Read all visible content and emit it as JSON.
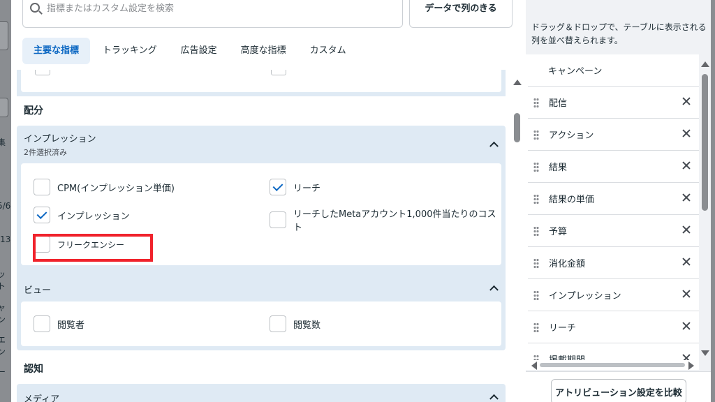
{
  "background": {
    "left_fragments": [
      "集",
      "5/6",
      "/13",
      "ット",
      "ャン",
      "エン",
      "ー"
    ]
  },
  "search": {
    "placeholder": "指標またはカスタム設定を検索"
  },
  "compare_top_label": "データで列のきる",
  "tabs": [
    {
      "label": "主要な指標",
      "active": true
    },
    {
      "label": "トラッキング",
      "active": false
    },
    {
      "label": "広告設定",
      "active": false
    },
    {
      "label": "高度な指標",
      "active": false
    },
    {
      "label": "カスタム",
      "active": false
    }
  ],
  "sections": {
    "distribution": {
      "title": "配分",
      "impressions_group": {
        "title": "インプレッション",
        "subtitle": "2件選択済み",
        "options": [
          {
            "label": "CPM(インプレッション単価)",
            "checked": false
          },
          {
            "label": "リーチ",
            "checked": true
          },
          {
            "label": "インプレッション",
            "checked": true
          },
          {
            "label": "リーチしたMetaアカウント1,000件当たりのコスト",
            "checked": false
          },
          {
            "label": "フリークエンシー",
            "checked": false
          }
        ]
      },
      "views_group": {
        "title": "ビュー",
        "options": [
          {
            "label": "閲覧者",
            "checked": false
          },
          {
            "label": "閲覧数",
            "checked": false
          }
        ]
      }
    },
    "awareness": {
      "title": "認知",
      "media_group": {
        "title": "メディア"
      }
    }
  },
  "right_panel": {
    "hint": "ドラッグ＆ドロップで、テーブルに表示される列を並べ替えられます。",
    "columns": [
      {
        "label": "キャンペーン",
        "fixed": true
      },
      {
        "label": "配信"
      },
      {
        "label": "アクション"
      },
      {
        "label": "結果"
      },
      {
        "label": "結果の単価"
      },
      {
        "label": "予算"
      },
      {
        "label": "消化金額"
      },
      {
        "label": "インプレッション"
      },
      {
        "label": "リーチ"
      },
      {
        "label": "掲載期間"
      }
    ],
    "compare_button": "アトリビューション設定を比較"
  },
  "colors": {
    "accent": "#0a66c2",
    "highlight_box": "#f0232c",
    "section_bg": "#dfeaf4"
  }
}
